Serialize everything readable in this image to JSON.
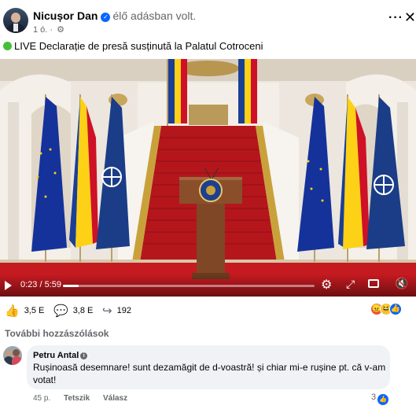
{
  "post": {
    "author": "Nicușor Dan",
    "status": "élő adásban volt.",
    "time": "1 ó.",
    "more_icon": "more-horizontal-icon",
    "close_icon": "close-icon",
    "caption": "LIVE Declarație de presă susținută la Palatul Cotroceni"
  },
  "video": {
    "current_time": "0:23",
    "duration": "5:59",
    "time_display": "0:23 / 5:59",
    "progress": 0.064
  },
  "reactions": {
    "like_count": "3,5 E",
    "comment_count": "3,8 E",
    "share_count": "192"
  },
  "comments": {
    "more_label": "További hozzászólások",
    "items": [
      {
        "author": "Petru Antal",
        "text": "Rușinoasă desemnare! sunt dezamăgit de d-voastră! și chiar mi-e rușine pt. că v-am votat!",
        "time": "45 p.",
        "like_action": "Tetszik",
        "reply_action": "Válasz",
        "likes": "3"
      }
    ]
  },
  "colors": {
    "accent": "#0866ff",
    "live": "#44c036",
    "carpet": "#b5161c",
    "gold": "#c9a13b"
  }
}
